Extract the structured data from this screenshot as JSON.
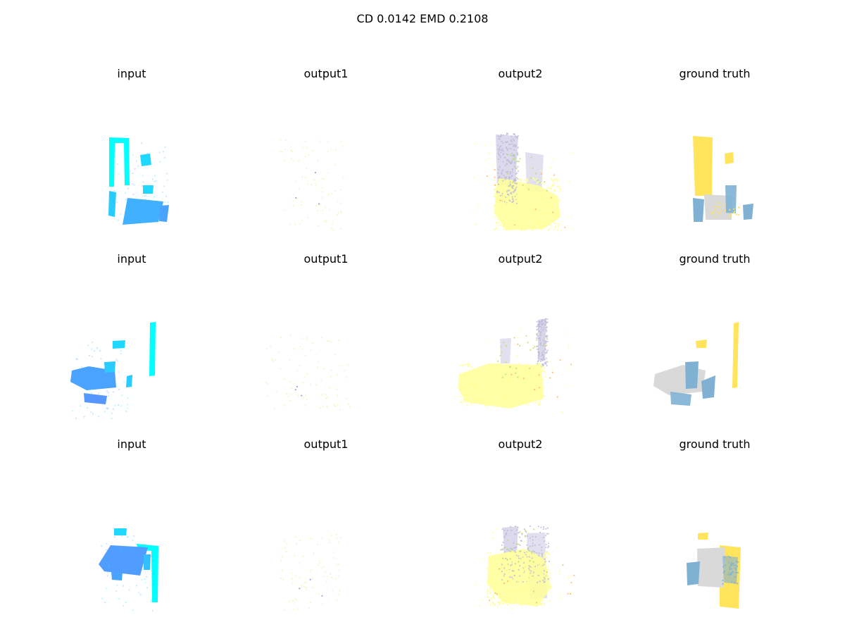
{
  "title": "CD 0.0142  EMD 0.2108",
  "chart_data": {
    "type": "scatter",
    "title": "CD 0.0142  EMD 0.2108",
    "metrics": {
      "CD": 0.0142,
      "EMD": 0.2108
    },
    "grid": false,
    "axes_visible": false,
    "column_titles": [
      "input",
      "output1",
      "output2",
      "ground truth"
    ],
    "rows": [
      {
        "views": [
          "input",
          "output1",
          "output2",
          "ground truth"
        ]
      },
      {
        "views": [
          "input",
          "output1",
          "output2",
          "ground truth"
        ]
      },
      {
        "views": [
          "input",
          "output1",
          "output2",
          "ground truth"
        ]
      }
    ],
    "colors": {
      "input_near": "#00ffff",
      "input_far": "#6a7cff",
      "output_yellow": "#ffff99",
      "output_purple": "#bebada",
      "output_green": "#b3de69",
      "output_orange": "#fdb462",
      "gt_wall": "#ffe45c",
      "gt_chair": "#80b1d3",
      "gt_table": "#d9d9d9"
    }
  }
}
